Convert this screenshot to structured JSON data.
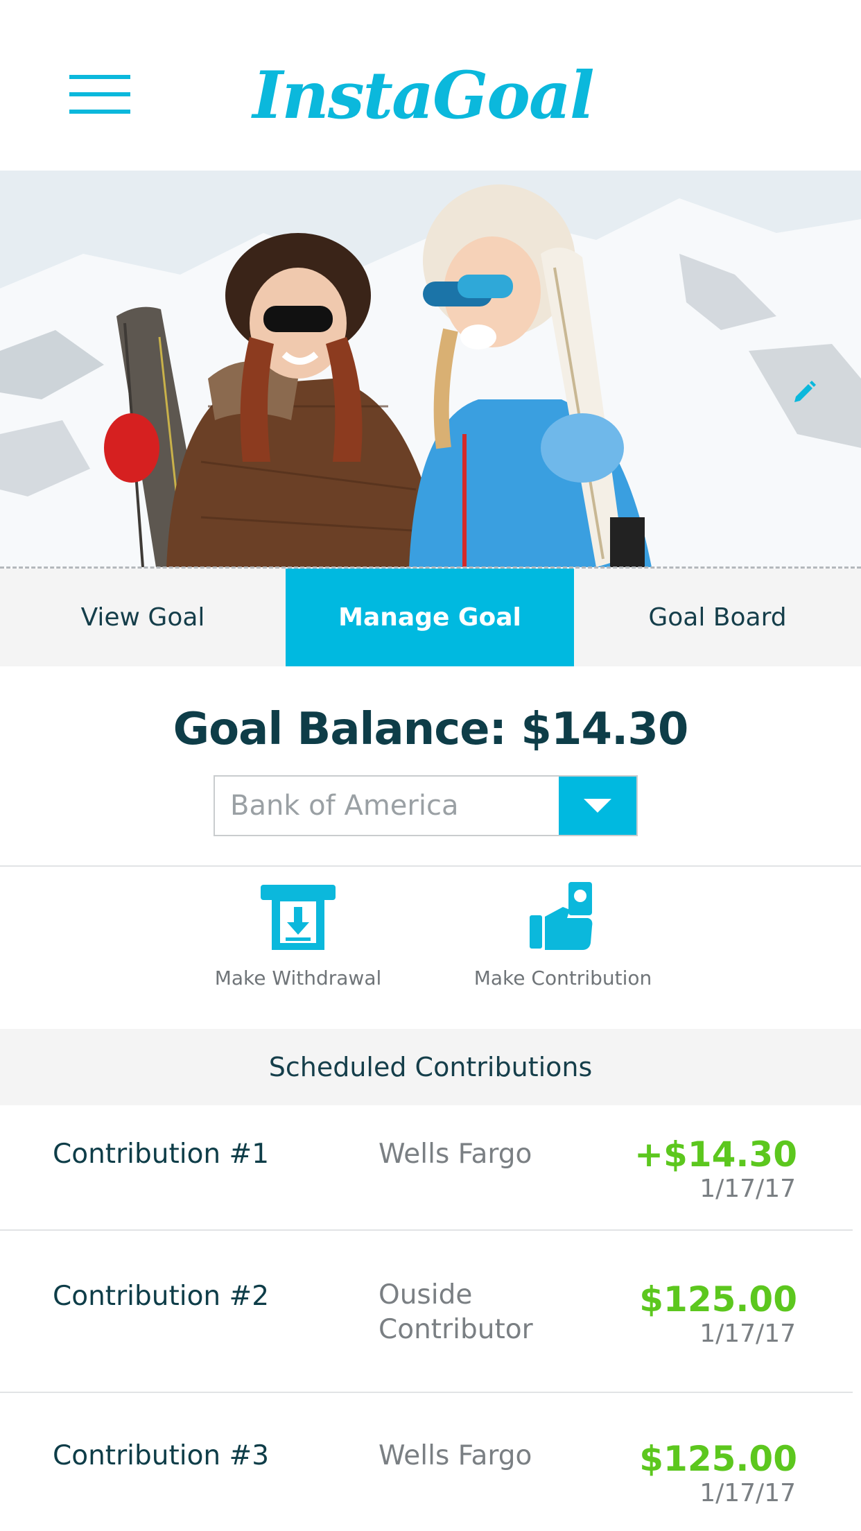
{
  "app": {
    "title": "InstaGoal"
  },
  "header": {
    "menu_icon": "hamburger-menu-icon",
    "edit_icon": "pencil-icon"
  },
  "tabs": [
    {
      "label": "View Goal",
      "active": false
    },
    {
      "label": "Manage Goal",
      "active": true
    },
    {
      "label": "Goal Board",
      "active": false
    }
  ],
  "goal": {
    "balance_label": "Goal Balance: $14.30",
    "account_select": {
      "value": "Bank of America",
      "icon": "caret-down-icon"
    }
  },
  "actions": [
    {
      "label": "Make Withdrawal",
      "icon": "atm-withdrawal-icon"
    },
    {
      "label": "Make Contribution",
      "icon": "hand-holding-cash-icon"
    }
  ],
  "scheduled": {
    "title": "Scheduled Contributions",
    "rows": [
      {
        "name": "Contribution #1",
        "source": "Wells Fargo",
        "amount": "+$14.30",
        "date": "1/17/17"
      },
      {
        "name": "Contribution #2",
        "source": "Ouside Contributor",
        "amount": "$125.00",
        "date": "1/17/17"
      },
      {
        "name": "Contribution #3",
        "source": "Wells Fargo",
        "amount": "$125.00",
        "date": "1/17/17"
      }
    ]
  },
  "colors": {
    "brand": "#0bb8dc",
    "active_tab": "#00b9e0",
    "heading": "#0e3d48",
    "amount": "#5cc71e"
  }
}
